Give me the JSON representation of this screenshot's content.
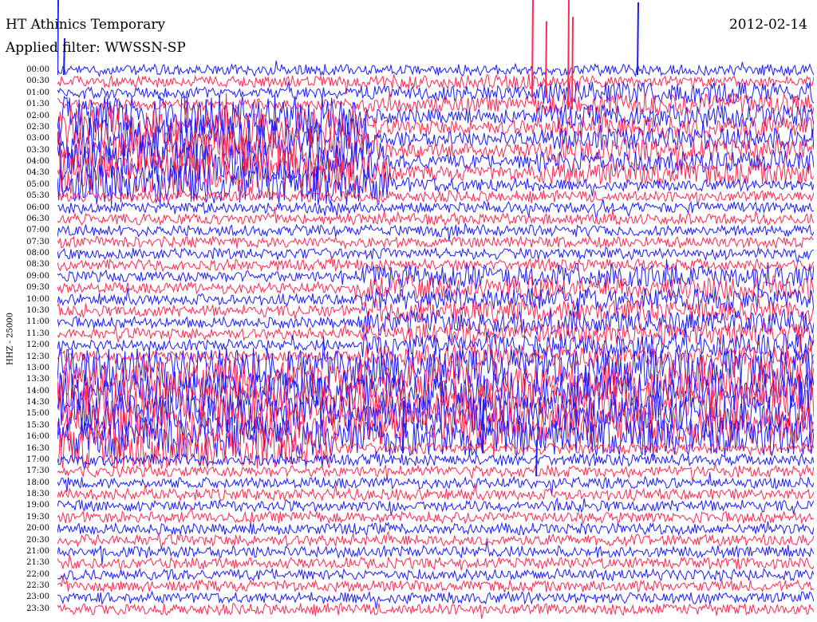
{
  "header": {
    "title": "HT Athinics Temporary",
    "filter": "Applied filter: WWSSN-SP",
    "date": "2012-02-14"
  },
  "chart_data": {
    "type": "line",
    "title": "HT Athinics Temporary",
    "subtitle": "Applied filter: WWSSN-SP",
    "date": "2012-02-14",
    "ylabel": "HHZ - 25000",
    "xlabel": "",
    "grid": false,
    "legend": "none",
    "colors": [
      "#1a1aff",
      "#ff2850"
    ],
    "hour_labels": [
      "00:00",
      "00:30",
      "01:00",
      "01:30",
      "02:00",
      "02:30",
      "03:00",
      "03:30",
      "04:00",
      "04:30",
      "05:00",
      "05:30",
      "06:00",
      "06:30",
      "07:00",
      "07:30",
      "08:00",
      "08:30",
      "09:00",
      "09:30",
      "10:00",
      "10:30",
      "11:00",
      "11:30",
      "12:00",
      "12:30",
      "13:00",
      "13:30",
      "14:00",
      "14:30",
      "15:00",
      "15:30",
      "16:00",
      "16:30",
      "17:00",
      "17:30",
      "18:00",
      "18:30",
      "19:00",
      "19:30",
      "20:00",
      "20:30",
      "21:00",
      "21:30",
      "22:00",
      "22:30",
      "23:00",
      "23:30"
    ],
    "x_range_minutes": [
      0,
      30
    ],
    "y_scale_counts": 25000
  }
}
